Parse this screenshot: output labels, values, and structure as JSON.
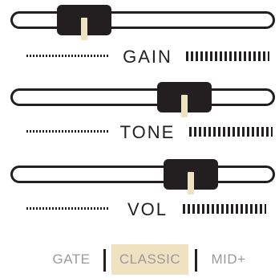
{
  "faders": [
    {
      "id": "gain",
      "label": "GAIN",
      "value": 0.22
    },
    {
      "id": "tone",
      "label": "TONE",
      "value": 0.7
    },
    {
      "id": "vol",
      "label": "VOL",
      "value": 0.73
    }
  ],
  "modes": {
    "options": [
      "GATE",
      "CLASSIC",
      "MID+"
    ],
    "selected": "CLASSIC"
  },
  "colors": {
    "ink": "#231f20",
    "accent": "#efe2c0",
    "muted": "#9b9a99",
    "background": "#ffffff"
  }
}
